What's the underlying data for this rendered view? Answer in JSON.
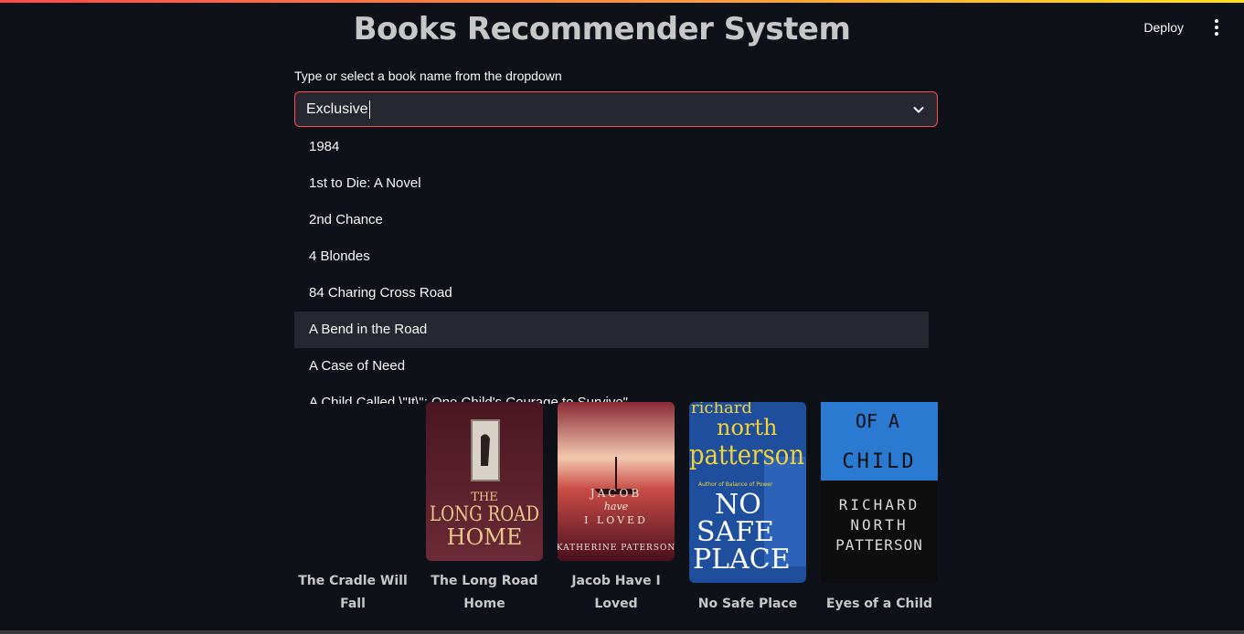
{
  "app": {
    "title": "Books Recommender System",
    "deploy_label": "Deploy"
  },
  "select": {
    "label": "Type or select a book name from the dropdown",
    "value": "Exclusive"
  },
  "dropdown": {
    "items": [
      "1984",
      "1st to Die: A Novel",
      "2nd Chance",
      "4 Blondes",
      "84 Charing Cross Road",
      "A Bend in the Road",
      "A Case of Need",
      "A Child Called \\\"It\\\": One Child's Courage to Survive\""
    ],
    "highlighted_index": 5
  },
  "books": [
    {
      "title": "The Cradle Will Fall"
    },
    {
      "title": "The Long Road Home",
      "cover_text": [
        "THE",
        "LONG ROAD",
        "HOME"
      ]
    },
    {
      "title": "Jacob Have I Loved",
      "cover_text": [
        "JACOB",
        "have",
        "I LOVED",
        "KATHERINE PATERSON"
      ]
    },
    {
      "title": "No Safe Place",
      "cover_text": [
        "richard",
        "north",
        "patterson",
        "Author of Balance of Power",
        "NO",
        "SAFE",
        "PLACE"
      ]
    },
    {
      "title": "Eyes of a Child",
      "cover_text": [
        "OF A",
        "CHILD",
        "RICHARD",
        "NORTH",
        "PATTERSON"
      ]
    }
  ],
  "colors": {
    "background": "#0e1117",
    "accent": "#ff4b4b",
    "input_bg": "#262730",
    "title_text": "#c7c7c7"
  }
}
